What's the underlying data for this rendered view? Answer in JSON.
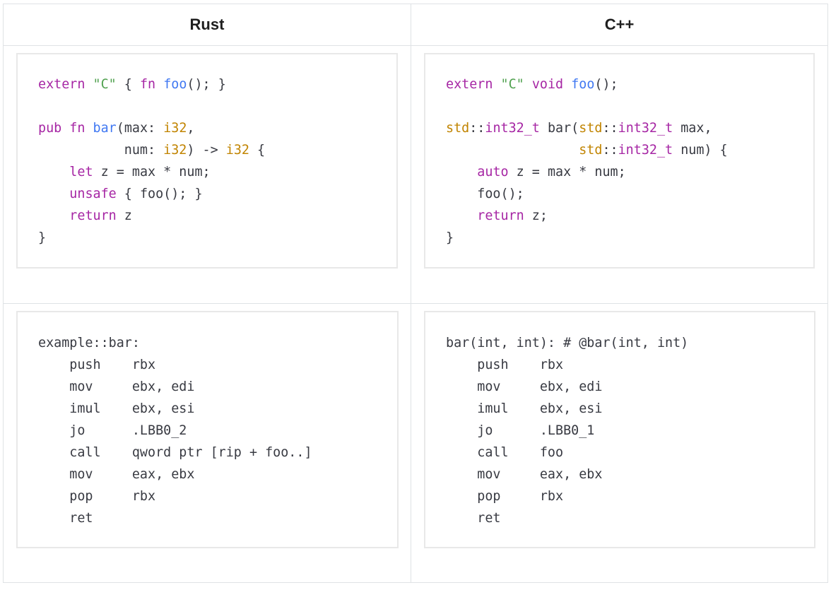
{
  "headers": {
    "rust": "Rust",
    "cpp": "C++"
  },
  "rust_source": [
    [
      {
        "t": "kw",
        "v": "extern"
      },
      {
        "t": "p",
        "v": " "
      },
      {
        "t": "str",
        "v": "\"C\""
      },
      {
        "t": "p",
        "v": " { "
      },
      {
        "t": "kw",
        "v": "fn"
      },
      {
        "t": "p",
        "v": " "
      },
      {
        "t": "fn",
        "v": "foo"
      },
      {
        "t": "p",
        "v": "(); }"
      }
    ],
    [],
    [
      {
        "t": "kw",
        "v": "pub"
      },
      {
        "t": "p",
        "v": " "
      },
      {
        "t": "kw",
        "v": "fn"
      },
      {
        "t": "p",
        "v": " "
      },
      {
        "t": "fn",
        "v": "bar"
      },
      {
        "t": "p",
        "v": "(max: "
      },
      {
        "t": "ty",
        "v": "i32"
      },
      {
        "t": "p",
        "v": ","
      }
    ],
    [
      {
        "t": "p",
        "v": "           num: "
      },
      {
        "t": "ty",
        "v": "i32"
      },
      {
        "t": "p",
        "v": ") -> "
      },
      {
        "t": "ty",
        "v": "i32"
      },
      {
        "t": "p",
        "v": " {"
      }
    ],
    [
      {
        "t": "p",
        "v": "    "
      },
      {
        "t": "kw",
        "v": "let"
      },
      {
        "t": "p",
        "v": " z = max * num;"
      }
    ],
    [
      {
        "t": "p",
        "v": "    "
      },
      {
        "t": "kw",
        "v": "unsafe"
      },
      {
        "t": "p",
        "v": " { foo(); }"
      }
    ],
    [
      {
        "t": "p",
        "v": "    "
      },
      {
        "t": "kw",
        "v": "return"
      },
      {
        "t": "p",
        "v": " z"
      }
    ],
    [
      {
        "t": "p",
        "v": "}"
      }
    ]
  ],
  "cpp_source": [
    [
      {
        "t": "kw",
        "v": "extern"
      },
      {
        "t": "p",
        "v": " "
      },
      {
        "t": "str",
        "v": "\"C\""
      },
      {
        "t": "p",
        "v": " "
      },
      {
        "t": "kw",
        "v": "void"
      },
      {
        "t": "p",
        "v": " "
      },
      {
        "t": "fn",
        "v": "foo"
      },
      {
        "t": "p",
        "v": "();"
      }
    ],
    [],
    [
      {
        "t": "ty",
        "v": "std"
      },
      {
        "t": "p",
        "v": "::"
      },
      {
        "t": "kw",
        "v": "int32_t"
      },
      {
        "t": "p",
        "v": " bar("
      },
      {
        "t": "ty",
        "v": "std"
      },
      {
        "t": "p",
        "v": "::"
      },
      {
        "t": "kw",
        "v": "int32_t"
      },
      {
        "t": "p",
        "v": " max,"
      }
    ],
    [
      {
        "t": "p",
        "v": "                 "
      },
      {
        "t": "ty",
        "v": "std"
      },
      {
        "t": "p",
        "v": "::"
      },
      {
        "t": "kw",
        "v": "int32_t"
      },
      {
        "t": "p",
        "v": " num) {"
      }
    ],
    [
      {
        "t": "p",
        "v": "    "
      },
      {
        "t": "kw",
        "v": "auto"
      },
      {
        "t": "p",
        "v": " z = max * num;"
      }
    ],
    [
      {
        "t": "p",
        "v": "    foo();"
      }
    ],
    [
      {
        "t": "p",
        "v": "    "
      },
      {
        "t": "kw",
        "v": "return"
      },
      {
        "t": "p",
        "v": " z;"
      }
    ],
    [
      {
        "t": "p",
        "v": "}"
      }
    ]
  ],
  "rust_asm": [
    "example::bar:",
    "    push    rbx",
    "    mov     ebx, edi",
    "    imul    ebx, esi",
    "    jo      .LBB0_2",
    "    call    qword ptr [rip + foo..]",
    "    mov     eax, ebx",
    "    pop     rbx",
    "    ret"
  ],
  "cpp_asm": [
    "bar(int, int): # @bar(int, int)",
    "    push    rbx",
    "    mov     ebx, edi",
    "    imul    ebx, esi",
    "    jo      .LBB0_1",
    "    call    foo",
    "    mov     eax, ebx",
    "    pop     rbx",
    "    ret"
  ]
}
